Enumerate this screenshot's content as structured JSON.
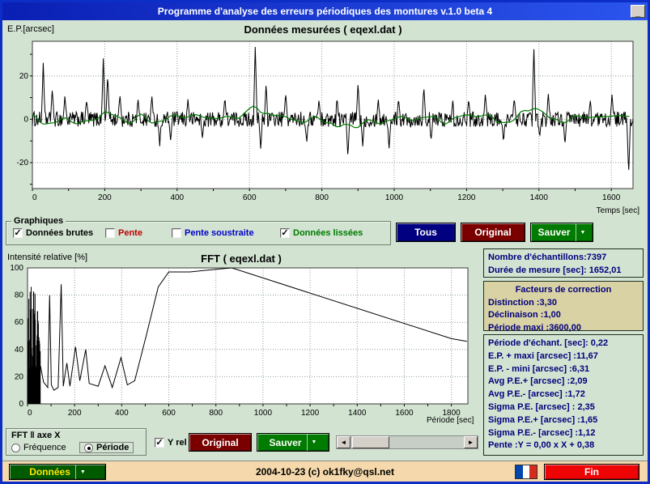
{
  "window": {
    "title": "Programme d'analyse des erreurs périodiques des montures v.1.0 beta 4"
  },
  "icons": {
    "minimize": "_",
    "check": "✓",
    "dropdown": "▼",
    "arrow_left": "◄",
    "arrow_right": "►"
  },
  "graphiques": {
    "group_label": "Graphiques",
    "checkboxes": [
      {
        "label": "Données brutes",
        "checked": true,
        "color": "#000000"
      },
      {
        "label": "Pente",
        "checked": false,
        "color": "#c00000"
      },
      {
        "label": "Pente soustraite",
        "checked": false,
        "color": "#0000c8"
      },
      {
        "label": "Données lissées",
        "checked": true,
        "color": "#007a00"
      }
    ],
    "buttons": [
      {
        "label": "Tous",
        "bg": "#000080",
        "fg": "#ffffff"
      },
      {
        "label": "Original",
        "bg": "#7a0000",
        "fg": "#ffffff"
      },
      {
        "label": "Sauver",
        "bg": "#007a00",
        "fg": "#ffffff",
        "dropdown": true
      }
    ]
  },
  "fft_controls": {
    "group_label": "FFT ‖ axe X",
    "radios": [
      {
        "label": "Fréquence",
        "selected": false
      },
      {
        "label": "Période",
        "selected": true
      }
    ],
    "y_rel": {
      "label": "Y rel",
      "checked": true
    },
    "buttons": [
      {
        "label": "Original",
        "bg": "#7a0000",
        "fg": "#ffffff"
      },
      {
        "label": "Sauver",
        "bg": "#007a00",
        "fg": "#ffffff",
        "dropdown": true
      }
    ]
  },
  "info_panel": {
    "lines": [
      "Nombre d'échantillons:7397",
      "Durée de mesure [sec]: 1652,01"
    ]
  },
  "correction_panel": {
    "title": "Facteurs de correction",
    "lines": [
      "Distinction :3,30",
      "Déclinaison :1,00",
      "Période maxi :3600,00"
    ]
  },
  "stats_panel": {
    "lines": [
      "Période d'échant. [sec]: 0,22",
      "E.P. + maxi [arcsec] :11,67",
      "E.P. - mini [arcsec] :6,31",
      "Avg P.E.+ [arcsec] :2,09",
      "Avg P.E.- [arcsec] :1,72",
      "Sigma P.E. [arcsec] : 2,35",
      "Sigma P.E.+ [arcsec] :1,65",
      "Sigma P.E.- [arcsec] :1,12",
      "Pente :Y = 0,00 x X + 0,38"
    ]
  },
  "bottom_bar": {
    "donnees_label": "Données",
    "donnees_bg": "#005a00",
    "donnees_fg": "#ffe400",
    "copyright": "2004-10-23 (c) ok1fky@qsl.net",
    "fin_label": "Fin",
    "fin_bg": "#ee0404",
    "flag_colors": [
      "#0046ad",
      "#ffffff",
      "#d52b1e"
    ]
  },
  "chart_data": [
    {
      "id": "measured",
      "type": "line",
      "title": "Données mesurées ( eqexl.dat )",
      "ylabel": "E.P.[arcsec]",
      "xlabel": "Temps [sec]",
      "xlim": [
        0,
        1660
      ],
      "ylim": [
        -32,
        36
      ],
      "xticks": [
        0,
        200,
        400,
        600,
        800,
        1000,
        1200,
        1400,
        1600
      ],
      "yticks": [
        -20,
        0,
        20
      ],
      "xminor": 100,
      "yminor": 10,
      "grid": true,
      "series": [
        {
          "name": "Données brutes",
          "color": "#000000",
          "style": "noisy",
          "baseline": 0,
          "noise_amp": 3.5,
          "spikes": [
            [
              30,
              26
            ],
            [
              55,
              14
            ],
            [
              90,
              11
            ],
            [
              150,
              9
            ],
            [
              196,
              29
            ],
            [
              208,
              21
            ],
            [
              242,
              12
            ],
            [
              292,
              9
            ],
            [
              330,
              11
            ],
            [
              352,
              -12
            ],
            [
              382,
              -10
            ],
            [
              430,
              9
            ],
            [
              470,
              -9
            ],
            [
              532,
              10
            ],
            [
              616,
              34
            ],
            [
              631,
              -14
            ],
            [
              646,
              16
            ],
            [
              700,
              12
            ],
            [
              758,
              -11
            ],
            [
              792,
              9
            ],
            [
              842,
              10
            ],
            [
              872,
              -18
            ],
            [
              900,
              17
            ],
            [
              913,
              -12
            ],
            [
              956,
              9
            ],
            [
              986,
              -14
            ],
            [
              1012,
              10
            ],
            [
              1082,
              15
            ],
            [
              1102,
              -10
            ],
            [
              1162,
              9
            ],
            [
              1206,
              10
            ],
            [
              1252,
              12
            ],
            [
              1302,
              -11
            ],
            [
              1332,
              10
            ],
            [
              1386,
              33
            ],
            [
              1402,
              -9
            ],
            [
              1426,
              12
            ],
            [
              1472,
              -12
            ],
            [
              1542,
              9
            ],
            [
              1602,
              11
            ],
            [
              1648,
              -26
            ]
          ]
        },
        {
          "name": "Données lissées",
          "color": "#007a00",
          "style": "smooth",
          "baseline": 0,
          "noise_amp": 2.5,
          "bumps": [
            [
              200,
              5
            ],
            [
              616,
              7
            ],
            [
              872,
              -5
            ],
            [
              1386,
              6
            ]
          ]
        }
      ]
    },
    {
      "id": "fft",
      "type": "line",
      "title": "FFT ( eqexl.dat )",
      "ylabel": "Intensité relative [%]",
      "xlabel": "Période [sec]",
      "xlim": [
        0,
        1870
      ],
      "ylim": [
        0,
        100
      ],
      "xticks": [
        0,
        200,
        400,
        600,
        800,
        1000,
        1200,
        1400,
        1600,
        1800
      ],
      "yticks": [
        0,
        20,
        40,
        60,
        80,
        100
      ],
      "xminor": 100,
      "grid": true,
      "series": [
        {
          "name": "FFT low-period cluster",
          "color": "#000000",
          "style": "dense-bars",
          "x_range": [
            0,
            55
          ],
          "min": 12,
          "max": 92
        },
        {
          "name": "FFT spectrum",
          "color": "#000000",
          "style": "polyline",
          "points": [
            [
              55,
              28
            ],
            [
              68,
              16
            ],
            [
              86,
              12
            ],
            [
              94,
              80
            ],
            [
              101,
              14
            ],
            [
              112,
              10
            ],
            [
              130,
              12
            ],
            [
              143,
              88
            ],
            [
              152,
              13
            ],
            [
              167,
              30
            ],
            [
              180,
              13
            ],
            [
              204,
              42
            ],
            [
              222,
              17
            ],
            [
              247,
              40
            ],
            [
              262,
              15
            ],
            [
              300,
              13
            ],
            [
              329,
              28
            ],
            [
              360,
              12
            ],
            [
              397,
              34
            ],
            [
              424,
              14
            ],
            [
              455,
              17
            ],
            [
              504,
              50
            ],
            [
              555,
              86
            ],
            [
              600,
              97
            ],
            [
              690,
              97
            ],
            [
              800,
              99
            ],
            [
              868,
              100
            ],
            [
              1800,
              48
            ],
            [
              1866,
              46
            ]
          ]
        }
      ]
    }
  ]
}
